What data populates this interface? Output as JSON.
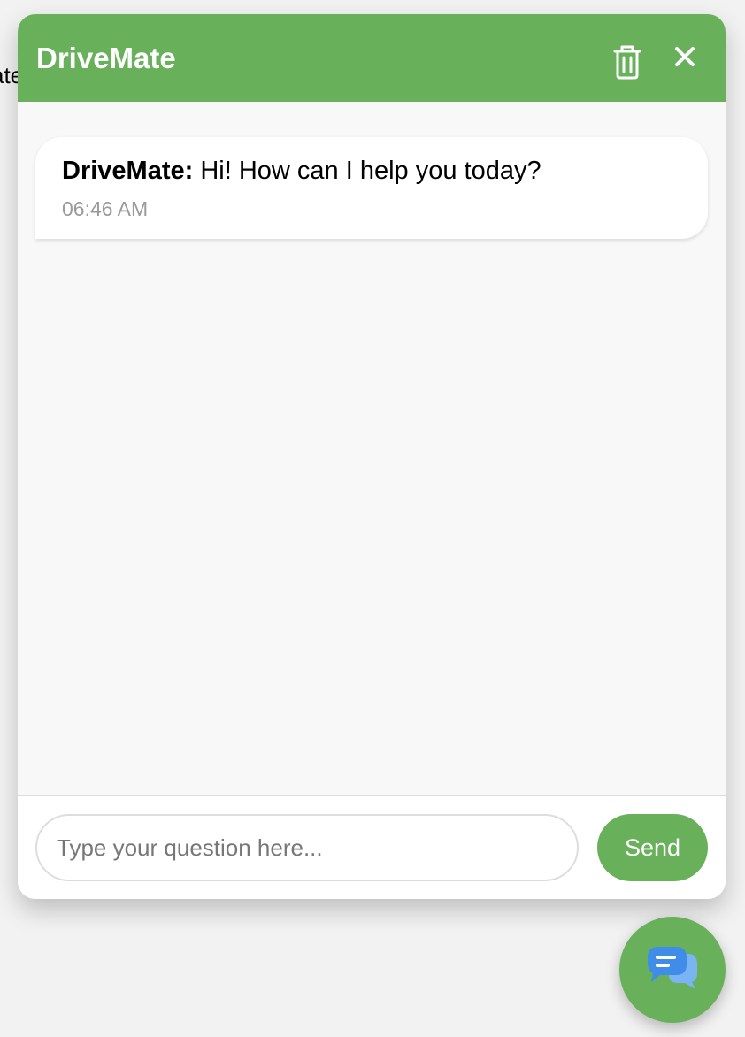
{
  "background": {
    "peek_text": "ate"
  },
  "header": {
    "title": "DriveMate",
    "delete_icon": "trash-icon",
    "close_icon": "close-icon"
  },
  "messages": [
    {
      "sender": "DriveMate:",
      "text": " Hi! How can I help you today?",
      "time": "06:46 AM"
    }
  ],
  "input": {
    "value": "",
    "placeholder": "Type your question here..."
  },
  "send_button": {
    "label": "Send"
  },
  "launcher": {
    "icon": "chat-bubbles-icon"
  },
  "colors": {
    "accent_green": "#69b05b",
    "icon_blue_dark": "#3f8de8",
    "icon_blue_light": "#7bb4f2",
    "timestamp_gray": "#999999"
  }
}
